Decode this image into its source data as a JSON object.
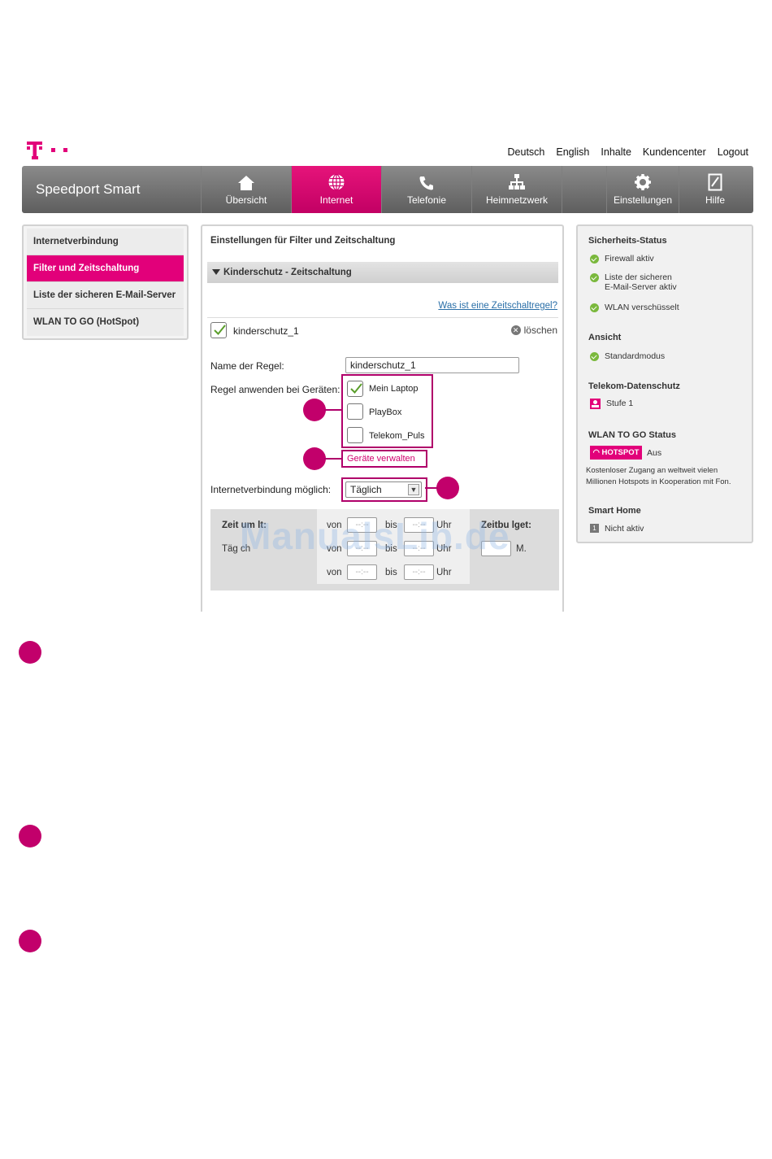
{
  "top_links": [
    "Deutsch",
    "English",
    "Inhalte",
    "Kundencenter",
    "Logout"
  ],
  "brand": "Speedport Smart",
  "nav": [
    {
      "label": "Übersicht",
      "icon": "home-icon"
    },
    {
      "label": "Internet",
      "icon": "globe-icon"
    },
    {
      "label": "Telefonie",
      "icon": "phone-icon"
    },
    {
      "label": "Heimnetzwerk",
      "icon": "network-icon"
    },
    {
      "label": "Einstellungen",
      "icon": "gear-icon"
    },
    {
      "label": "Hilfe",
      "icon": "help-book-icon"
    }
  ],
  "left_menu": [
    "Internetverbindung",
    "Filter und Zeitschaltung",
    "Liste der sicheren E-Mail-Server",
    "WLAN TO GO (HotSpot)"
  ],
  "main": {
    "title": "Einstellungen für Filter und Zeitschaltung",
    "section": "Kinderschutz - Zeitschaltung",
    "help_link": "Was ist eine Zeitschaltregel?",
    "rule_checkbox_label": "kinderschutz_1",
    "delete_label": "löschen",
    "rule_name_label": "Name der Regel:",
    "rule_name_value": "kinderschutz_1",
    "devices_label": "Regel anwenden bei Geräten:",
    "devices": [
      {
        "label": "Mein Laptop",
        "checked": true
      },
      {
        "label": "PlayBox",
        "checked": false
      },
      {
        "label": "Telekom_Puls",
        "checked": false
      }
    ],
    "manage_link": "Geräte verwalten",
    "connection_label": "Internetverbindung möglich:",
    "connection_value": "Täglich",
    "time_box": {
      "left_label": "Zeit  um  lt:",
      "left_sub": "Täg ch",
      "von": "von",
      "bis": "bis",
      "uhr": "Uhr",
      "placeholder": "--:--",
      "right_label": "Zeitbu lget:",
      "right_unit": "M."
    }
  },
  "right": {
    "security_title": "Sicherheits-Status",
    "security_items": [
      "Firewall aktiv",
      "Liste der sicheren",
      "E-Mail-Server aktiv",
      "WLAN verschüsselt"
    ],
    "view_title": "Ansicht",
    "view_item": "Standardmodus",
    "privacy_title": "Telekom-Datenschutz",
    "privacy_item": "Stufe 1",
    "wlan_title": "WLAN TO GO Status",
    "hotspot_badge": "HOTSPOT",
    "hotspot_status": "Aus",
    "hotspot_text": "Kostenloser Zugang an weltweit vielen Millionen Hotspots in Kooperation mit Fon.",
    "smart_home_title": "Smart Home",
    "smart_home_item": "Nicht aktiv"
  },
  "watermark": "ManualsLib.de",
  "colors": {
    "accent": "#e2007a",
    "navbar": "#6e6e6e",
    "ok": "#7ab83c",
    "link": "#2a6fa8"
  }
}
